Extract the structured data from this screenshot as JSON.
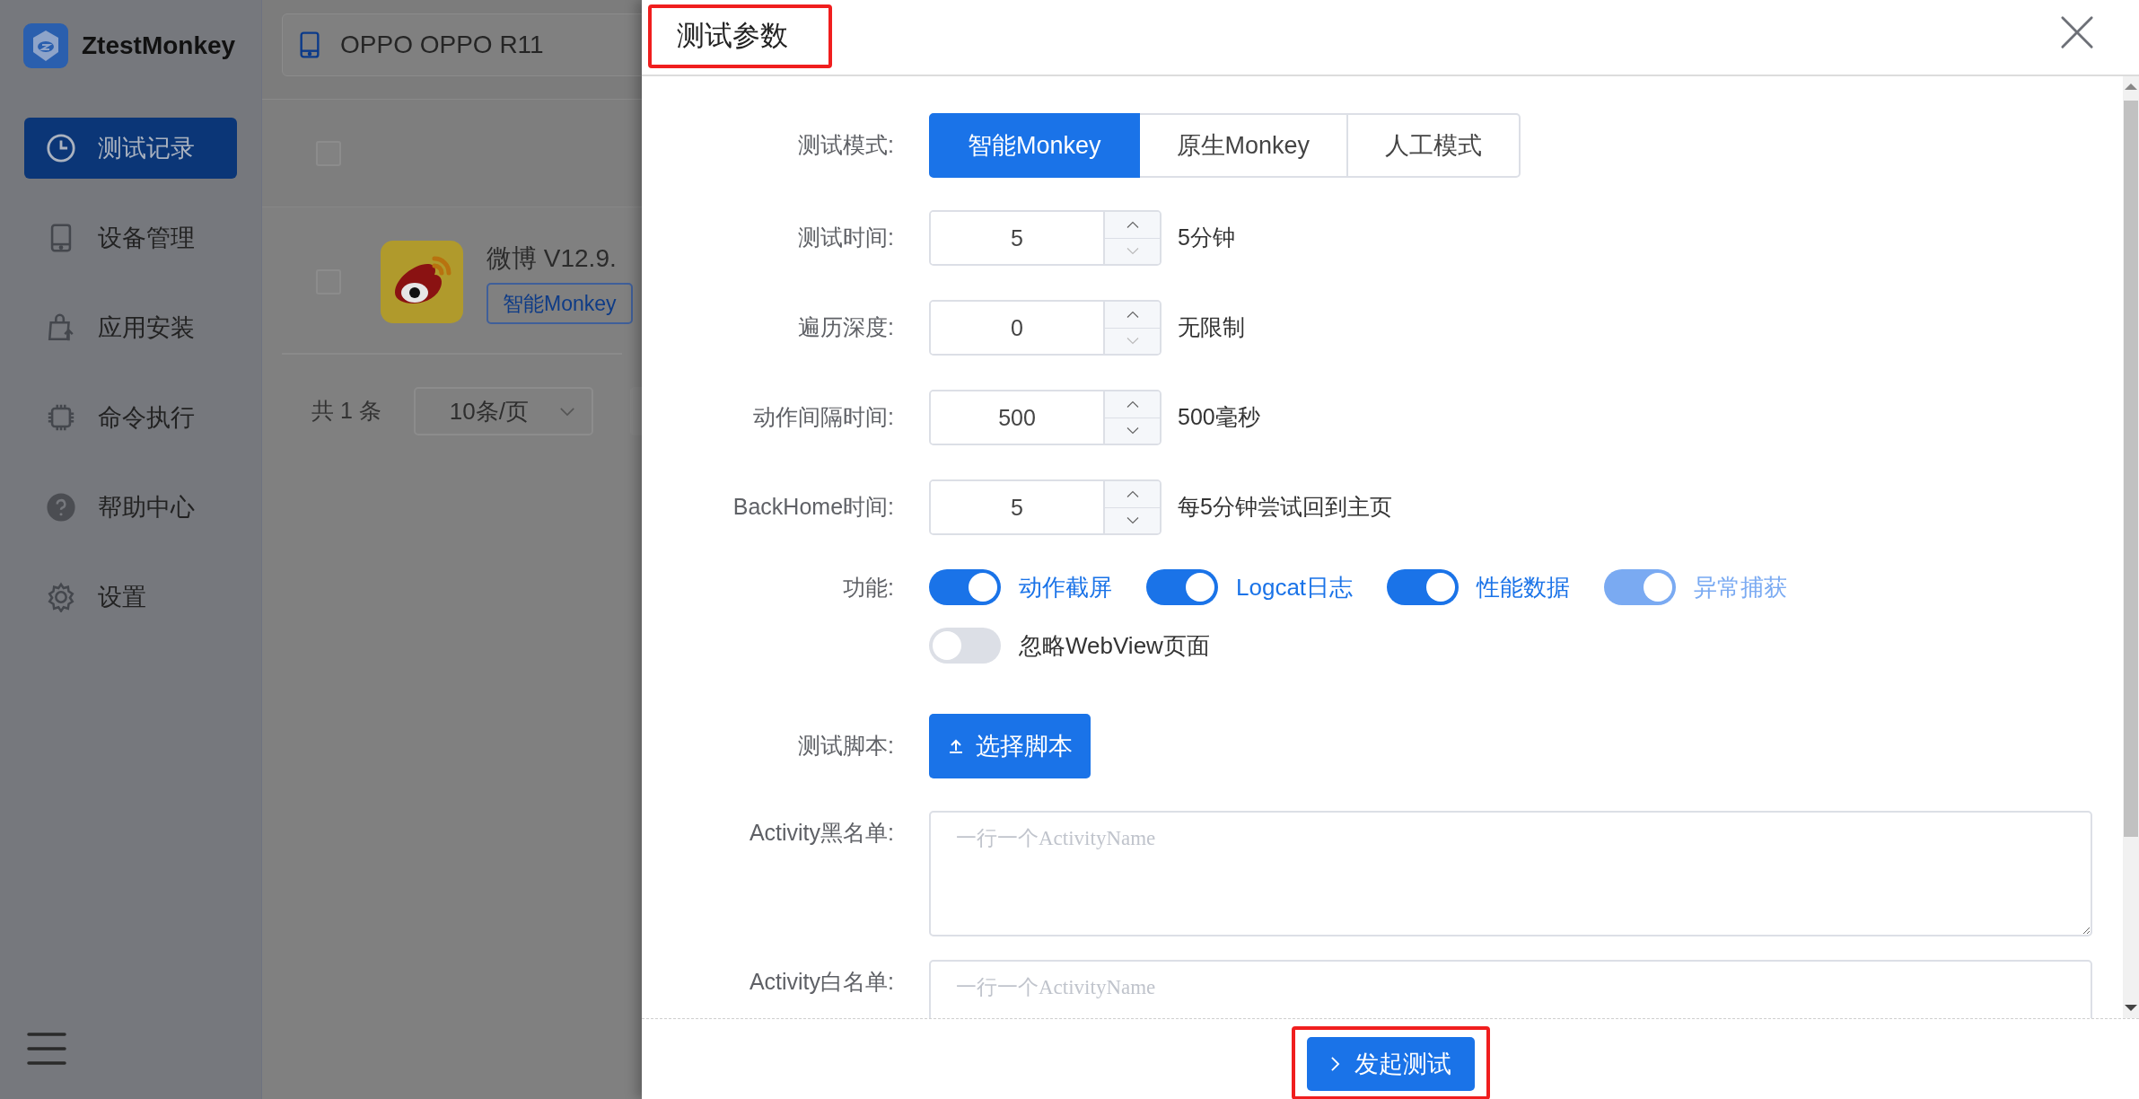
{
  "sidebar": {
    "app_name": "ZtestMonkey",
    "nav_items": [
      {
        "kind": "clock",
        "label": "测试记录",
        "selected": true
      },
      {
        "kind": "phone",
        "label": "设备管理",
        "selected": false
      },
      {
        "kind": "bag",
        "label": "应用安装",
        "selected": false
      },
      {
        "kind": "chip",
        "label": "命令执行",
        "selected": false
      },
      {
        "kind": "help",
        "label": "帮助中心",
        "selected": false
      },
      {
        "kind": "gear",
        "label": "设置",
        "selected": false
      }
    ]
  },
  "background": {
    "device_selector": {
      "value": "OPPO OPPO R11"
    },
    "table": {
      "header_checked": false,
      "rows": [
        {
          "checked": false,
          "app_name": "微博 V12.9.",
          "tag": "智能Monkey"
        }
      ]
    },
    "pagination": {
      "total": "共 1 条",
      "page_size": "10条/页"
    }
  },
  "dialog": {
    "title": "测试参数",
    "mode": {
      "label": "测试模式:",
      "options": [
        {
          "label": "智能Monkey",
          "selected": true
        },
        {
          "label": "原生Monkey",
          "selected": false
        },
        {
          "label": "人工模式",
          "selected": false
        }
      ]
    },
    "number_fields": [
      {
        "label": "测试时间:",
        "value": "5",
        "hint": "5分钟"
      },
      {
        "label": "遍历深度:",
        "value": "0",
        "hint": "无限制"
      },
      {
        "label": "动作间隔时间:",
        "value": "500",
        "hint": "500毫秒"
      },
      {
        "label": "BackHome时间:",
        "value": "5",
        "hint": "每5分钟尝试回到主页"
      }
    ],
    "features": {
      "label": "功能:",
      "items": [
        {
          "label": "动作截屏",
          "on": true,
          "disabled": false
        },
        {
          "label": "Logcat日志",
          "on": true,
          "disabled": false
        },
        {
          "label": "性能数据",
          "on": true,
          "disabled": false
        },
        {
          "label": "异常捕获",
          "on": true,
          "disabled": true
        },
        {
          "label": "忽略WebView页面",
          "on": false,
          "disabled": false
        }
      ]
    },
    "script": {
      "label": "测试脚本:",
      "button": "选择脚本"
    },
    "textareas": [
      {
        "label": "Activity黑名单:",
        "placeholder": "一行一个ActivityName"
      },
      {
        "label": "Activity白名单:",
        "placeholder": "一行一个ActivityName"
      }
    ],
    "submit": "发起测试"
  }
}
